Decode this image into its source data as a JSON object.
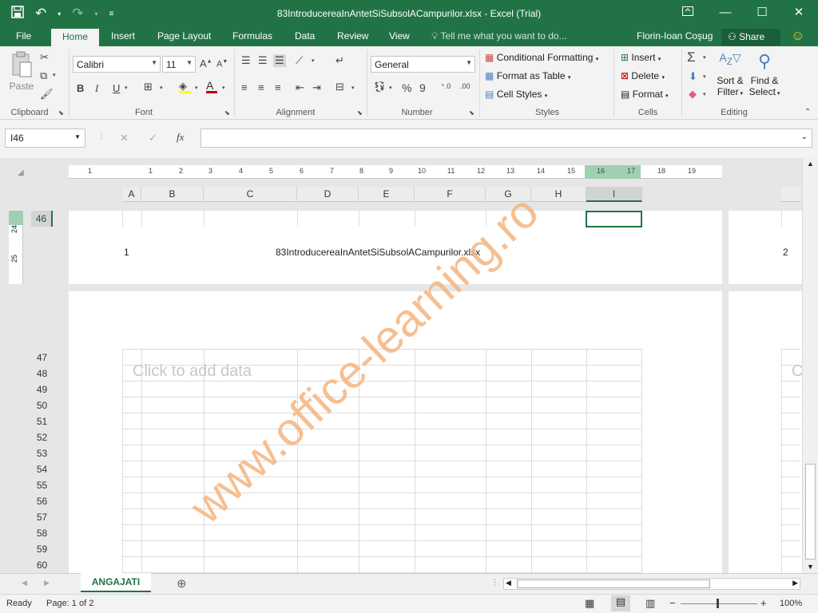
{
  "window": {
    "title": "83IntroducereaInAntetSiSubsolACampurilor.xlsx - Excel (Trial)"
  },
  "ribbon_tabs": [
    "File",
    "Home",
    "Insert",
    "Page Layout",
    "Formulas",
    "Data",
    "Review",
    "View"
  ],
  "active_tab": "Home",
  "tell_me": "Tell me what you want to do...",
  "user": "Florin-Ioan Coşug",
  "share": "Share",
  "clipboard": {
    "paste": "Paste",
    "label": "Clipboard"
  },
  "font": {
    "name": "Calibri",
    "size": "11",
    "label": "Font",
    "bold": "B",
    "italic": "I",
    "underline": "U"
  },
  "alignment": {
    "label": "Alignment"
  },
  "number": {
    "format": "General",
    "label": "Number",
    "percent": "%",
    "comma": "9"
  },
  "styles": {
    "conditional": "Conditional Formatting",
    "format_table": "Format as Table",
    "cell_styles": "Cell Styles",
    "label": "Styles"
  },
  "cells": {
    "insert": "Insert",
    "delete": "Delete",
    "format": "Format",
    "label": "Cells"
  },
  "editing": {
    "sort1": "Sort &",
    "sort2": "Filter",
    "find1": "Find &",
    "find2": "Select",
    "label": "Editing"
  },
  "formula_bar": {
    "name_box": "I46",
    "fx": "fx",
    "content": ""
  },
  "ruler_numbers": [
    "1",
    "1",
    "2",
    "3",
    "4",
    "5",
    "6",
    "7",
    "8",
    "9",
    "10",
    "11",
    "12",
    "13",
    "14",
    "15",
    "16",
    "17",
    "18",
    "19"
  ],
  "vertical_ruler": [
    "24",
    "25"
  ],
  "columns": [
    "A",
    "B",
    "C",
    "D",
    "E",
    "F",
    "G",
    "H",
    "I"
  ],
  "selected_column": "I",
  "selected_row": "46",
  "rows_top": [
    "46"
  ],
  "rows_bottom": [
    "47",
    "48",
    "49",
    "50",
    "51",
    "52",
    "53",
    "54",
    "55",
    "56",
    "57",
    "58",
    "59",
    "60"
  ],
  "footer": {
    "left": "1",
    "center": "83IntroducereaInAntetSiSubsolACampurilor.xlsx",
    "right_page": "2"
  },
  "placeholder": "Click to add data",
  "placeholder_right": "C",
  "watermark": "www.office-learning.ro",
  "sheet_tab": "ANGAJATI",
  "status": {
    "ready": "Ready",
    "page": "Page: 1 of 2",
    "zoom": "100%",
    "minus": "−",
    "plus": "+"
  },
  "colors": {
    "accent": "#217346",
    "watermark": "#f5a360"
  }
}
